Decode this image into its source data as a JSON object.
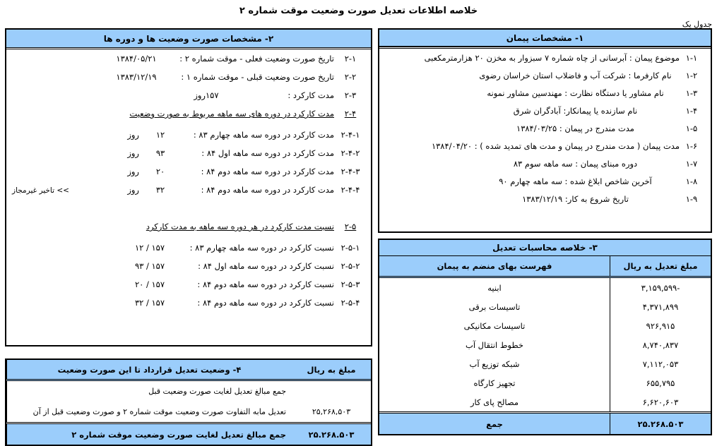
{
  "document": {
    "title": "خلاصه اطلاعات تعدیل صورت وضعیت موقت شماره ۲",
    "sheet_label": "جدول یک",
    "colors": {
      "header_blue": "#9BCDFB",
      "border": "#000000",
      "page_bg": "#FFFFFF"
    }
  },
  "section1": {
    "header": "۱- مشخصات پیمان",
    "rows": [
      {
        "num": "۱-۱",
        "text": "موضوع پیمان : آبرسانی از چاه شماره ۷ سبزوار به مخزن ۲۰ هزارمترمکعبی"
      },
      {
        "num": "۱-۲",
        "text": "نام کارفرما : شرکت آب و فاضلاب استان خراسان رضوی"
      },
      {
        "num": "۱-۳",
        "text": "نام مشاور یا دستگاه نظارت : مهندسین مشاور نمونه"
      },
      {
        "num": "۱-۴",
        "text": "نام سازنده یا پیمانکار: آبادگران شرق"
      },
      {
        "num": "۱-۵",
        "text": "مدت مندرج در پیمان : ۱۳۸۴/۰۳/۲۵"
      },
      {
        "num": "۱-۶",
        "text": "مدت پیمان ( مدت مندرج در پیمان و مدت های تمدید شده ) : ۱۳۸۴/۰۴/۲۰"
      },
      {
        "num": "۱-۷",
        "text": "دوره مبنای پیمان : سه ماهه سوم ۸۳"
      },
      {
        "num": "۱-۸",
        "text": "آخرین شاخص ابلاغ شده : سه ماهه چهارم ۹۰"
      },
      {
        "num": "۱-۹",
        "text": "تاریخ شروع به کار: ۱۳۸۳/۱۲/۱۹"
      }
    ]
  },
  "section2": {
    "header": "۲- مشخصات صورت وضعیت ها و دوره ها",
    "rows": [
      {
        "num": "۲-۱",
        "label": "تاریخ صورت وضعیت فعلی  -  موقت شماره ۲ :",
        "value": "۱۳۸۴/۰۵/۲۱",
        "unit": "",
        "note": ""
      },
      {
        "num": "۲-۲",
        "label": "تاریخ صورت وضعیت قبلی -  موقت شماره ۱ :",
        "value": "۱۳۸۳/۱۲/۱۹",
        "unit": "",
        "note": ""
      },
      {
        "num": "۲-۳",
        "label": "مدت کارکرد :",
        "value": "۱۵۷",
        "unit": "روز",
        "note": ""
      }
    ],
    "group4": {
      "num": "۲-۴",
      "title": "مدت کارکرد در دوره های سه ماهه مربوط به صورت وضعیت",
      "rows": [
        {
          "num": "۲-۴-۱",
          "label": "مدت کارکرد در دوره  سه ماهه چهارم ۸۳  :",
          "value": "۱۲",
          "unit": "روز",
          "note": ""
        },
        {
          "num": "۲-۴-۲",
          "label": "مدت کارکرد در دوره  سه ماهه اول ۸۴  :",
          "value": "۹۳",
          "unit": "روز",
          "note": ""
        },
        {
          "num": "۲-۴-۳",
          "label": "مدت کارکرد در دوره  سه ماهه دوم ۸۴  :",
          "value": "۲۰",
          "unit": "روز",
          "note": ""
        },
        {
          "num": "۲-۴-۴",
          "label": "مدت کارکرد در دوره  سه ماهه دوم ۸۴  :",
          "value": "۳۲",
          "unit": "روز",
          "note": ">> تاخیر غیرمجاز"
        }
      ]
    },
    "group5": {
      "num": "۲-۵",
      "title": "نسبت مدت کارکرد در هر دوره سه ماهه به مدت کارکرد",
      "rows": [
        {
          "num": "۲-۵-۱",
          "label": "نسبت کارکرد در دوره  سه ماهه چهارم ۸۳  :",
          "value": "۱۵۷  /  ۱۲",
          "unit": "",
          "note": ""
        },
        {
          "num": "۲-۵-۲",
          "label": "نسبت کارکرد در دوره  سه ماهه اول ۸۴  :",
          "value": "۱۵۷  /  ۹۳",
          "unit": "",
          "note": ""
        },
        {
          "num": "۲-۵-۳",
          "label": "نسبت کارکرد در دوره  سه ماهه دوم ۸۴  :",
          "value": "۱۵۷  /  ۲۰",
          "unit": "",
          "note": ""
        },
        {
          "num": "۲-۵-۴",
          "label": "نسبت کارکرد در دوره  سه ماهه دوم ۸۴  :",
          "value": "۱۵۷  /  ۳۲",
          "unit": "",
          "note": ""
        }
      ]
    }
  },
  "section3": {
    "title": "۳- خلاصه محاسبات تعدیل",
    "columns": {
      "description": "فهرست بهای منضم به پیمان",
      "amount": "مبلغ تعدیل به ریال"
    },
    "rows": [
      {
        "description": "ابنیه",
        "amount": "-۳,۱۵۹,۵۹۹"
      },
      {
        "description": "تاسیسات برقی",
        "amount": "۴,۳۷۱,۸۹۹"
      },
      {
        "description": "تاسیسات مکانیکی",
        "amount": "۹۲۶,۹۱۵"
      },
      {
        "description": "خطوط انتقال آب",
        "amount": "۸,۷۴۰,۸۳۷"
      },
      {
        "description": "شبکه توزیع آب",
        "amount": "۷,۱۱۲,۰۵۳"
      },
      {
        "description": "تجهیز کارگاه",
        "amount": "۶۵۵,۷۹۵"
      },
      {
        "description": "مصالح پای کار",
        "amount": "۶,۶۲۰,۶۰۳"
      }
    ],
    "total": {
      "description": "جمع",
      "amount": "۲۵.۲۶۸.۵۰۳"
    }
  },
  "section4": {
    "columns": {
      "description": "۴- وضعیت تعدیل قرارداد تا این صورت وضعیت",
      "amount": "مبلغ به ریال"
    },
    "rows": [
      {
        "description": "جمع مبالغ تعدیل لغایت صورت وضعیت قبل",
        "amount": ""
      },
      {
        "description": "تعدیل مابه التفاوت صورت وضعیت موقت شماره ۲ و صورت وضعیت قبل از آن",
        "amount": "۲۵,۲۶۸,۵۰۳"
      }
    ],
    "total": {
      "description": "جمع مبالغ تعدیل لغایت صورت وضعیت موقت شماره ۲",
      "amount": "۲۵.۲۶۸.۵۰۳"
    }
  }
}
